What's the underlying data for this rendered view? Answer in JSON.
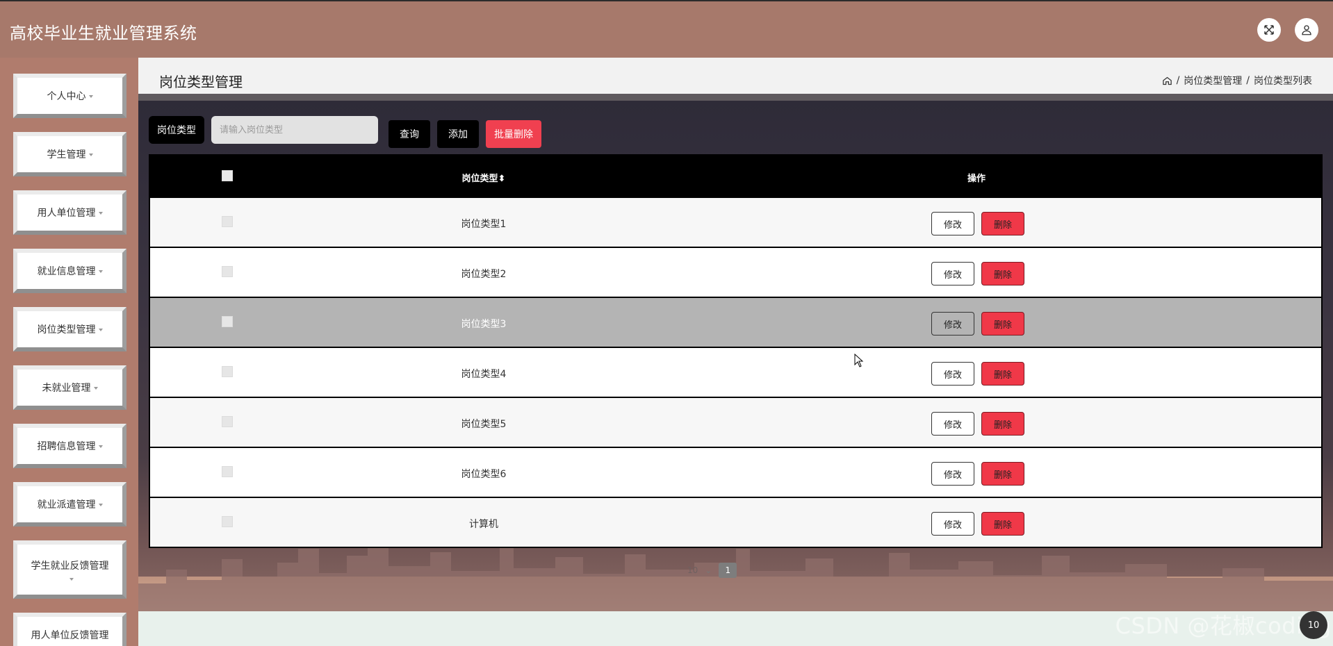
{
  "app": {
    "title": "高校毕业生就业管理系统"
  },
  "header": {
    "fullscreen_icon": "fullscreen-icon",
    "user_icon": "user-icon"
  },
  "sidebar": {
    "items": [
      {
        "label": "个人中心"
      },
      {
        "label": "学生管理"
      },
      {
        "label": "用人单位管理"
      },
      {
        "label": "就业信息管理"
      },
      {
        "label": "岗位类型管理"
      },
      {
        "label": "未就业管理"
      },
      {
        "label": "招聘信息管理"
      },
      {
        "label": "就业派遣管理"
      },
      {
        "label": "学生就业反馈管理"
      },
      {
        "label": "用人单位反馈管理"
      }
    ]
  },
  "page": {
    "title": "岗位类型管理",
    "breadcrumb": [
      "岗位类型管理",
      "岗位类型列表"
    ]
  },
  "search": {
    "label": "岗位类型",
    "placeholder": "请输入岗位类型",
    "value": "",
    "query_label": "查询",
    "add_label": "添加",
    "batch_delete_label": "批量删除"
  },
  "table": {
    "headers": {
      "type": "岗位类型",
      "sort_icon": "sort-icon",
      "operation": "操作"
    },
    "rows": [
      {
        "type": "岗位类型1",
        "edit": "修改",
        "delete": "删除"
      },
      {
        "type": "岗位类型2",
        "edit": "修改",
        "delete": "删除"
      },
      {
        "type": "岗位类型3",
        "edit": "修改",
        "delete": "删除"
      },
      {
        "type": "岗位类型4",
        "edit": "修改",
        "delete": "删除"
      },
      {
        "type": "岗位类型5",
        "edit": "修改",
        "delete": "删除"
      },
      {
        "type": "岗位类型6",
        "edit": "修改",
        "delete": "删除"
      },
      {
        "type": "计算机",
        "edit": "修改",
        "delete": "删除"
      }
    ],
    "hovered_row": 3
  },
  "pagination": {
    "page_size": "10",
    "current_page": "1"
  },
  "watermark": "CSDN @花椒coding",
  "corner_badge": "10",
  "colors": {
    "header": "#a7796b",
    "sidebar": "#b07c6d",
    "danger": "#f03848",
    "dark": "#000000"
  }
}
